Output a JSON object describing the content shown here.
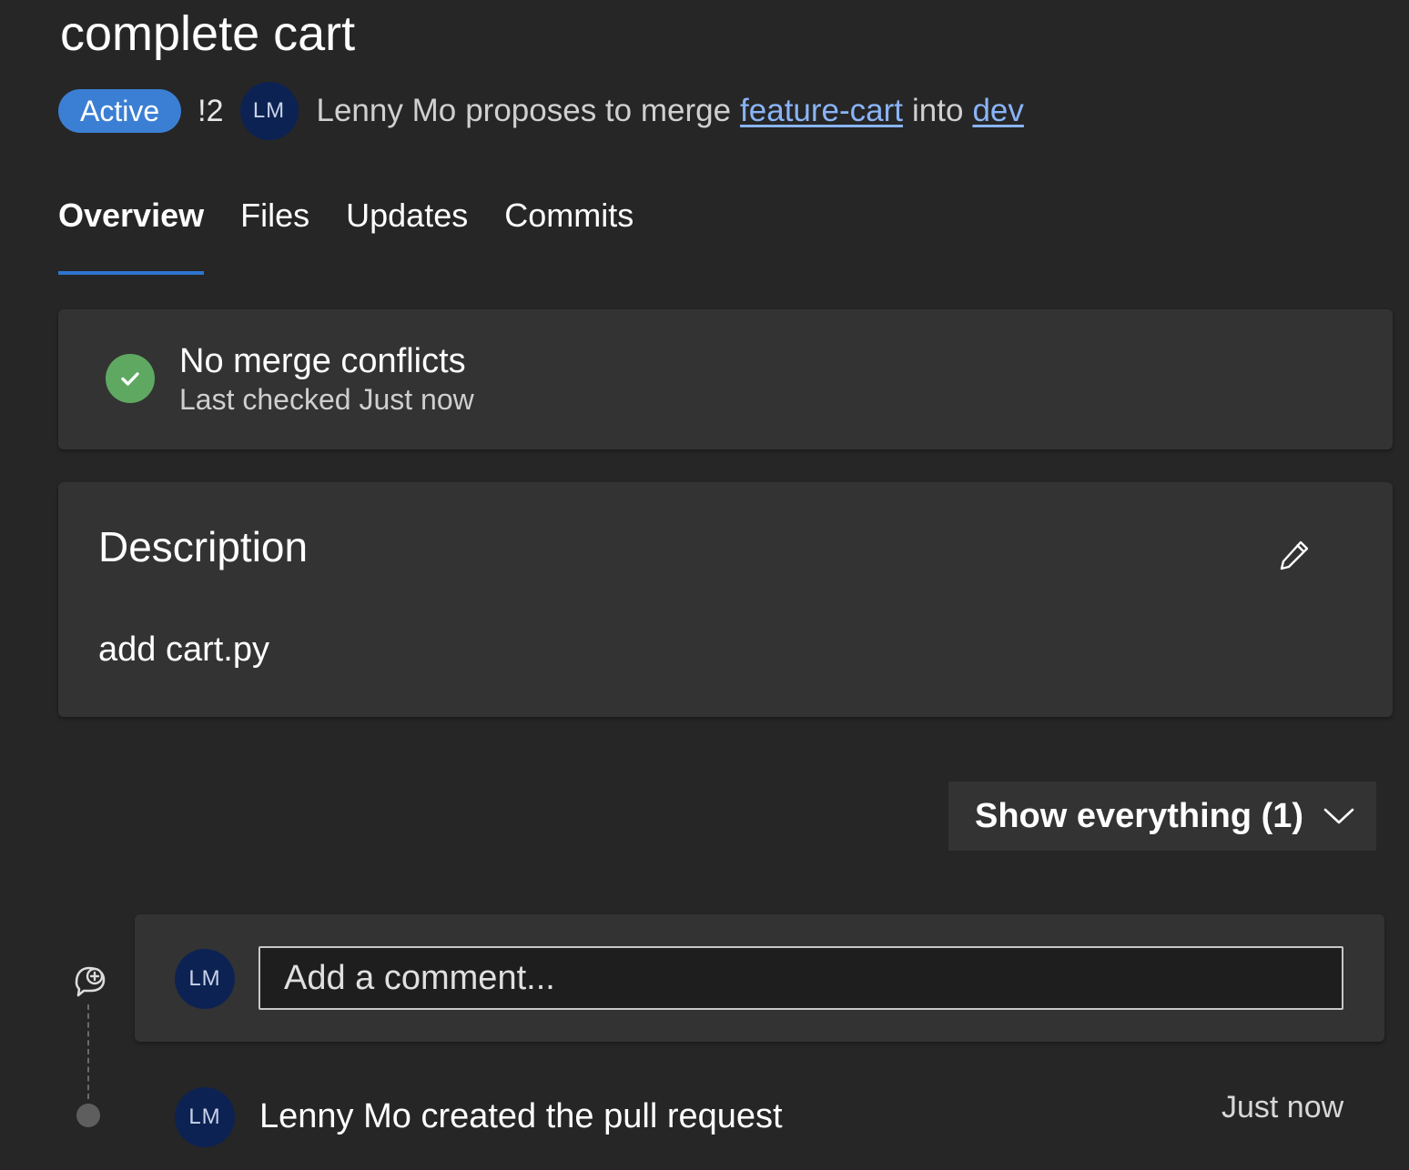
{
  "pr": {
    "title": "complete cart",
    "status": "Active",
    "id": "!2",
    "author_initials": "LM",
    "author_name": "Lenny Mo",
    "proposes_text": "proposes to merge",
    "source_branch": "feature-cart",
    "into_text": "into",
    "target_branch": "dev"
  },
  "tabs": [
    {
      "label": "Overview",
      "active": true
    },
    {
      "label": "Files",
      "active": false
    },
    {
      "label": "Updates",
      "active": false
    },
    {
      "label": "Commits",
      "active": false
    }
  ],
  "merge_status": {
    "title": "No merge conflicts",
    "subtitle": "Last checked Just now",
    "icon": "check-circle-icon",
    "color": "#5fa862"
  },
  "description": {
    "heading": "Description",
    "body": "add cart.py",
    "edit_icon": "pencil-icon"
  },
  "activity_filter": {
    "label": "Show everything (1)"
  },
  "comment_box": {
    "avatar_initials": "LM",
    "placeholder": "Add a comment..."
  },
  "timeline": [
    {
      "avatar_initials": "LM",
      "text": "Lenny Mo created the pull request",
      "time": "Just now"
    }
  ],
  "colors": {
    "background": "#262626",
    "card": "#333333",
    "accent": "#3b7fd4",
    "link": "#8ab4f8",
    "avatar": "#0c2253"
  }
}
